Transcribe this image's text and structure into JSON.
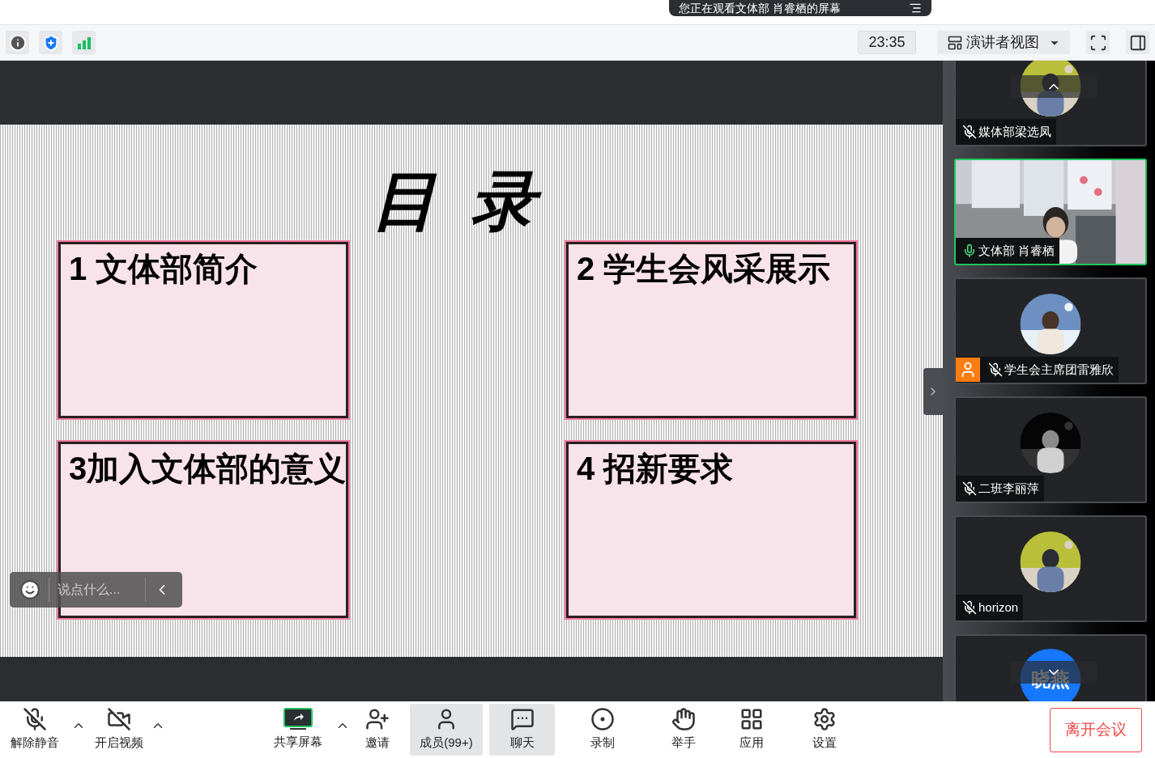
{
  "banner": {
    "text": "您正在观看文体部 肖睿栖的屏幕"
  },
  "top_bar": {
    "time": "23:35",
    "view_menu": {
      "label": "演讲者视图"
    }
  },
  "slide": {
    "title": "目 录",
    "sections": [
      "1 文体部简介",
      "2 学生会风采展示",
      "3加入文体部的意义",
      "4 招新要求"
    ]
  },
  "chat_input": {
    "placeholder": "说点什么..."
  },
  "participants": [
    {
      "kind": "avatar",
      "name": "媒体部梁选凤",
      "muted": true,
      "selected": false,
      "badge": false
    },
    {
      "kind": "video",
      "name": "文体部 肖睿栖",
      "muted": false,
      "selected": true,
      "badge": false
    },
    {
      "kind": "avatar",
      "name": "学生会主席团雷雅欣",
      "muted": true,
      "selected": false,
      "badge": true
    },
    {
      "kind": "avatar",
      "name": "二班李丽萍",
      "muted": true,
      "selected": false,
      "badge": false
    },
    {
      "kind": "avatar",
      "name": "horizon",
      "muted": true,
      "selected": false,
      "badge": false
    },
    {
      "kind": "initials",
      "initials": "晓燕",
      "selected": false
    }
  ],
  "toolbar": [
    {
      "label": "解除静音",
      "selected": false,
      "caret": true
    },
    {
      "label": "开启视频",
      "selected": false,
      "caret": true
    },
    {
      "label": "共享屏幕",
      "selected": false,
      "caret": true
    },
    {
      "label": "邀请",
      "selected": false,
      "caret": false
    },
    {
      "label": "成员(99+)",
      "selected": true,
      "caret": false
    },
    {
      "label": "聊天",
      "selected": true,
      "caret": false
    },
    {
      "label": "录制",
      "selected": false,
      "caret": false
    },
    {
      "label": "举手",
      "selected": false,
      "caret": false
    },
    {
      "label": "应用",
      "selected": false,
      "caret": false
    },
    {
      "label": "设置",
      "selected": false,
      "caret": false
    }
  ],
  "leave_button": {
    "label": "离开会议"
  }
}
